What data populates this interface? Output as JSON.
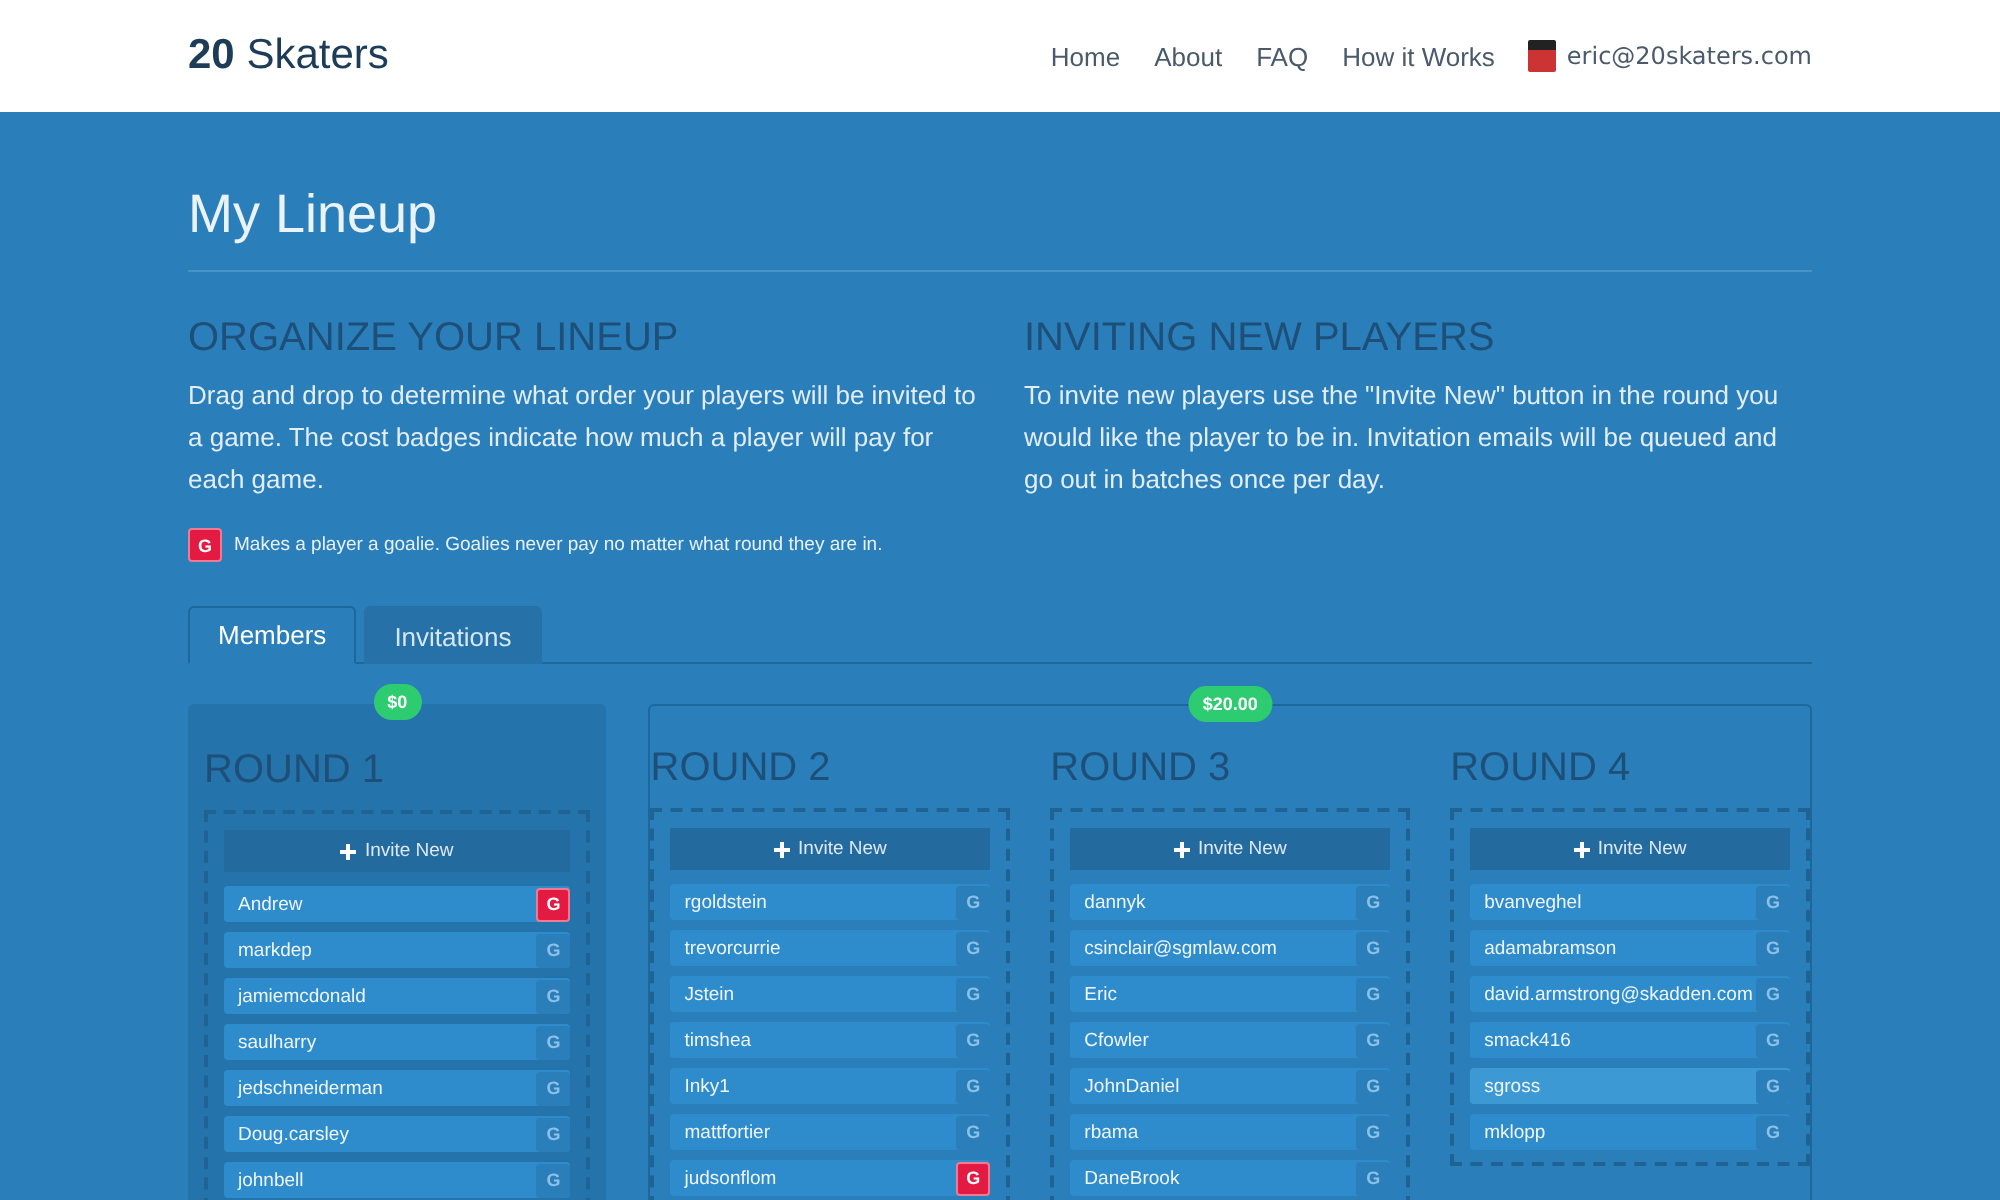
{
  "brand": {
    "number": "20",
    "name": "Skaters"
  },
  "nav": [
    {
      "label": "Home"
    },
    {
      "label": "About"
    },
    {
      "label": "FAQ"
    },
    {
      "label": "How it Works"
    }
  ],
  "user": {
    "email": "eric@20skaters.com"
  },
  "page_title": "My Lineup",
  "sections": [
    {
      "heading": "ORGANIZE YOUR LINEUP",
      "text": "Drag and drop to determine what order your players will be invited to a game. The cost badges indicate how much a player will pay for each game."
    },
    {
      "heading": "INVITING NEW PLAYERS",
      "text": "To invite new players use the \"Invite New\" button in the round you would like the player to be in. Invitation emails will be queued and go out in batches once per day."
    }
  ],
  "legend": {
    "badge": "G",
    "text": "Makes a player a goalie. Goalies never pay no matter what round they are in."
  },
  "tabs": [
    {
      "label": "Members",
      "selected": true
    },
    {
      "label": "Invitations",
      "selected": false
    }
  ],
  "price_groups": [
    {
      "price": "$0",
      "rounds": [
        {
          "title": "ROUND 1",
          "invite": "Invite New",
          "players": [
            {
              "name": "Andrew",
              "badge": "G",
              "goalie": true,
              "highlighted": false
            },
            {
              "name": "markdep",
              "badge": "G",
              "goalie": false,
              "highlighted": false
            },
            {
              "name": "jamiemcdonald",
              "badge": "G",
              "goalie": false,
              "highlighted": false
            },
            {
              "name": "saulharry",
              "badge": "G",
              "goalie": false,
              "highlighted": false
            },
            {
              "name": "jedschneiderman",
              "badge": "G",
              "goalie": false,
              "highlighted": false
            },
            {
              "name": "Doug.carsley",
              "badge": "G",
              "goalie": false,
              "highlighted": false
            },
            {
              "name": "johnbell",
              "badge": "G",
              "goalie": false,
              "highlighted": false
            }
          ]
        }
      ]
    },
    {
      "price": "$20.00",
      "rounds": [
        {
          "title": "ROUND 2",
          "invite": "Invite New",
          "players": [
            {
              "name": "rgoldstein",
              "badge": "G",
              "goalie": false,
              "highlighted": false
            },
            {
              "name": "trevorcurrie",
              "badge": "G",
              "goalie": false,
              "highlighted": false
            },
            {
              "name": "Jstein",
              "badge": "G",
              "goalie": false,
              "highlighted": false
            },
            {
              "name": "timshea",
              "badge": "G",
              "goalie": false,
              "highlighted": false
            },
            {
              "name": "Inky1",
              "badge": "G",
              "goalie": false,
              "highlighted": false
            },
            {
              "name": "mattfortier",
              "badge": "G",
              "goalie": false,
              "highlighted": false
            },
            {
              "name": "judsonflom",
              "badge": "G",
              "goalie": true,
              "highlighted": false
            }
          ]
        },
        {
          "title": "ROUND 3",
          "invite": "Invite New",
          "players": [
            {
              "name": "dannyk",
              "badge": "G",
              "goalie": false,
              "highlighted": false
            },
            {
              "name": "csinclair@sgmlaw.com",
              "badge": "G",
              "goalie": false,
              "highlighted": false
            },
            {
              "name": "Eric",
              "badge": "G",
              "goalie": false,
              "highlighted": false
            },
            {
              "name": "Cfowler",
              "badge": "G",
              "goalie": false,
              "highlighted": false
            },
            {
              "name": "JohnDaniel",
              "badge": "G",
              "goalie": false,
              "highlighted": false
            },
            {
              "name": "rbama",
              "badge": "G",
              "goalie": false,
              "highlighted": false
            },
            {
              "name": "DaneBrook",
              "badge": "G",
              "goalie": false,
              "highlighted": false
            }
          ]
        },
        {
          "title": "ROUND 4",
          "invite": "Invite New",
          "players": [
            {
              "name": "bvanveghel",
              "badge": "G",
              "goalie": false,
              "highlighted": false
            },
            {
              "name": "adamabramson",
              "badge": "G",
              "goalie": false,
              "highlighted": false
            },
            {
              "name": "david.armstrong@skadden.com",
              "badge": "G",
              "goalie": false,
              "highlighted": false
            },
            {
              "name": "smack416",
              "badge": "G",
              "goalie": false,
              "highlighted": false
            },
            {
              "name": "sgross",
              "badge": "G",
              "goalie": false,
              "highlighted": true
            },
            {
              "name": "mklopp",
              "badge": "G",
              "goalie": false,
              "highlighted": false
            }
          ]
        }
      ]
    }
  ]
}
